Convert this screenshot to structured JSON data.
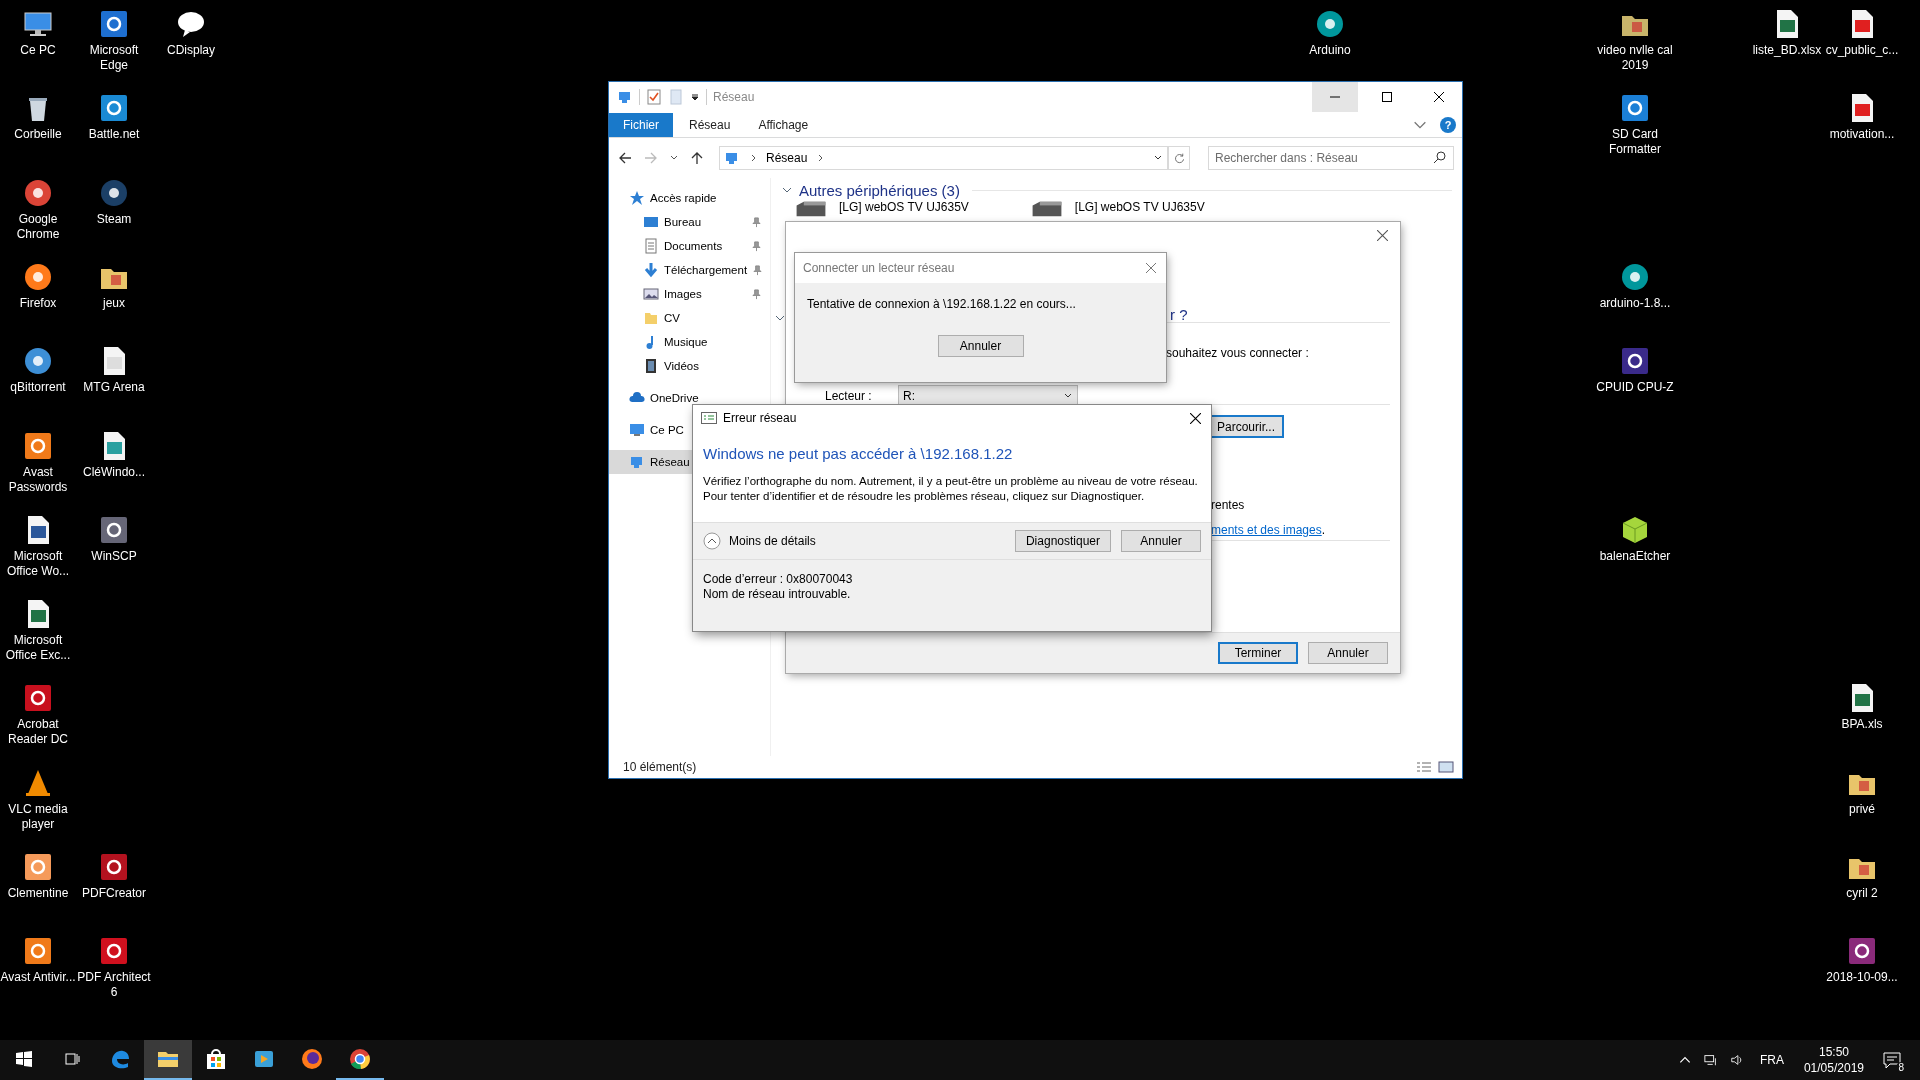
{
  "desktop_icons": [
    {
      "label": "Ce PC"
    },
    {
      "label": "Microsoft Edge"
    },
    {
      "label": "CDisplay"
    },
    {
      "label": "Corbeille"
    },
    {
      "label": "Battle.net"
    },
    {
      "label": "Google Chrome"
    },
    {
      "label": "Steam"
    },
    {
      "label": "Firefox"
    },
    {
      "label": "jeux"
    },
    {
      "label": "qBittorrent"
    },
    {
      "label": "MTG Arena"
    },
    {
      "label": "Avast Passwords"
    },
    {
      "label": "CléWindo..."
    },
    {
      "label": "Microsoft Office Wo..."
    },
    {
      "label": "WinSCP"
    },
    {
      "label": "Microsoft Office Exc..."
    },
    {
      "label": "Acrobat Reader DC"
    },
    {
      "label": "VLC media player"
    },
    {
      "label": "Clementine"
    },
    {
      "label": "PDFCreator"
    },
    {
      "label": "Avast Antivir..."
    },
    {
      "label": "PDF Architect 6"
    },
    {
      "label": "Arduino"
    },
    {
      "label": "video nvlle cal 2019"
    },
    {
      "label": "SD Card Formatter"
    },
    {
      "label": "arduino-1.8..."
    },
    {
      "label": "CPUID CPU-Z"
    },
    {
      "label": "balenaEtcher"
    },
    {
      "label": "liste_BD.xlsx"
    },
    {
      "label": "cv_public_c..."
    },
    {
      "label": "motivation..."
    },
    {
      "label": "BPA.xls"
    },
    {
      "label": "privé"
    },
    {
      "label": "cyril 2"
    },
    {
      "label": "2018-10-09..."
    }
  ],
  "explorer": {
    "title": "Réseau",
    "ribbon_tabs": [
      {
        "label": "Fichier",
        "selected": true
      },
      {
        "label": "Réseau",
        "selected": false
      },
      {
        "label": "Affichage",
        "selected": false
      }
    ],
    "help": "?",
    "address": "Réseau",
    "search": {
      "placeholder": "Rechercher dans : Réseau"
    },
    "nav": [
      {
        "label": "Accès rapide",
        "selected": false,
        "children": [
          {
            "label": "Bureau",
            "selected": false,
            "pinned": true
          },
          {
            "label": "Documents",
            "selected": false,
            "pinned": true
          },
          {
            "label": "Téléchargement",
            "selected": false,
            "pinned": true
          },
          {
            "label": "Images",
            "selected": false,
            "pinned": true
          },
          {
            "label": "CV",
            "selected": false,
            "pinned": false
          },
          {
            "label": "Musique",
            "selected": false,
            "pinned": false
          },
          {
            "label": "Vidéos",
            "selected": false,
            "pinned": false
          }
        ]
      },
      {
        "label": "OneDrive",
        "selected": false
      },
      {
        "label": "Ce PC",
        "selected": false
      },
      {
        "label": "Réseau",
        "selected": true
      }
    ],
    "groups": [
      {
        "title": "Autres périphériques (3)",
        "expanded": true,
        "items": [
          "[LG] webOS TV UJ635V",
          "[LG] webOS TV UJ635V"
        ]
      },
      {
        "expanded": true
      }
    ],
    "status": "10 élément(s)"
  },
  "wizard": {
    "heading_fragment": "r ?",
    "prompt_fragment": "souhaitez vous connecter :",
    "drive_label": "Lecteur :",
    "drive_value": "R:",
    "browse_button": {
      "label": "Parcourir...",
      "default": true
    },
    "option_fragment": "rentes",
    "link_fragment": "ments et des images",
    "link_tail": ".",
    "buttons": [
      {
        "label": "Terminer",
        "default": true
      },
      {
        "label": "Annuler",
        "default": false
      }
    ]
  },
  "connect_dialog": {
    "title": "Connecter un lecteur réseau",
    "message": "Tentative de connexion à \\192.168.1.22 en cours...",
    "button": "Annuler"
  },
  "error_dialog": {
    "title": "Erreur réseau",
    "heading": "Windows ne peut pas accéder à \\192.168.1.22",
    "body": "Vérifiez l’orthographe du nom. Autrement, il y a peut-être un problème au niveau de votre réseau. Pour tenter d’identifier et de résoudre les problèmes réseau, cliquez sur Diagnostiquer.",
    "details": {
      "label": "Moins de détails",
      "expanded": true
    },
    "buttons": [
      "Diagnostiquer",
      "Annuler"
    ],
    "detail_lines": [
      "Code d’erreur : 0x80070043",
      "Nom de réseau introuvable."
    ]
  },
  "taskbar": {
    "apps": [
      {
        "active": false,
        "running": false
      },
      {
        "active": true,
        "running": true
      },
      {
        "active": false,
        "running": false
      },
      {
        "active": false,
        "running": false
      },
      {
        "active": false,
        "running": false
      },
      {
        "active": false,
        "running": true
      }
    ],
    "language": "FRA",
    "time": "15:50",
    "date": "01/05/2019",
    "notifications": "8"
  }
}
